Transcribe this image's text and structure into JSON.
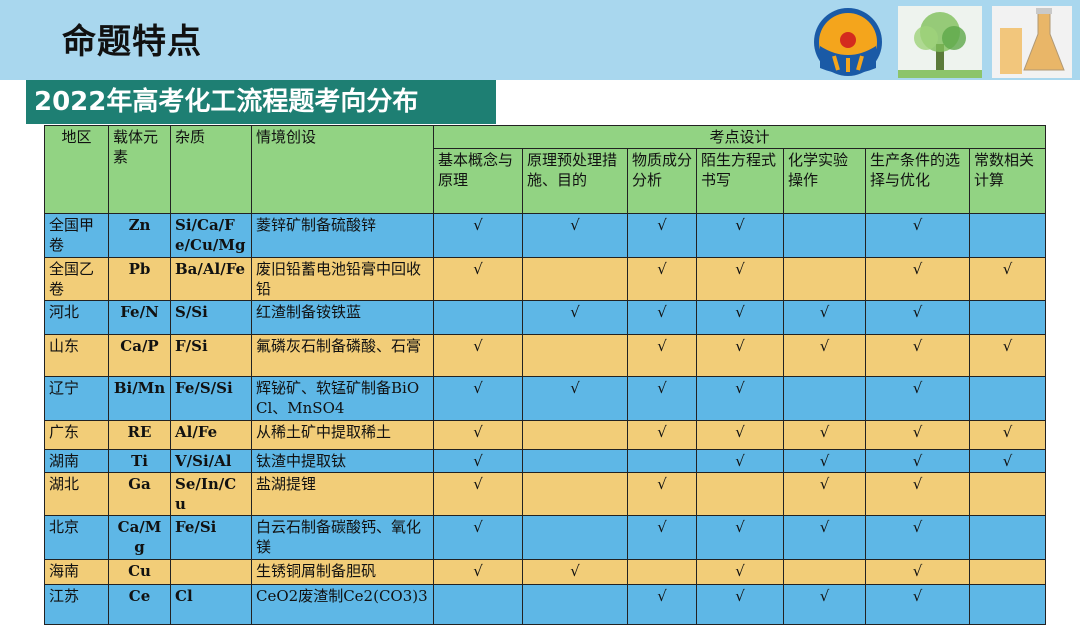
{
  "header": {
    "title": "命题特点",
    "subtitle": "2022年高考化工流程题考向分布"
  },
  "colors": {
    "header_bar": "#a9d7ee",
    "subtitle_bg": "#1e7f73",
    "table_header": "#92d383",
    "row_blue": "#5eb7e6",
    "row_yellow": "#f2cd78"
  },
  "table": {
    "columns": {
      "region": "地区",
      "carrier": "载体元素",
      "impurity": "杂质",
      "scenario": "情境创设",
      "design": "考点设计",
      "sub": [
        "基本概念与原理",
        "原理预处理措施、目的",
        "物质成分分析",
        "陌生方程式书写",
        "化学实验操作",
        "生产条件的选择与优化",
        "常数相关计算"
      ]
    },
    "rows": [
      {
        "region": "全国甲卷",
        "carrier": "Zn",
        "impurity": "Si/Ca/Fe/Cu/Mg",
        "scenario": "菱锌矿制备硫酸锌",
        "marks": [
          "√",
          "√",
          "√",
          "√",
          "",
          "√",
          ""
        ]
      },
      {
        "region": "全国乙卷",
        "carrier": "Pb",
        "impurity": "Ba/Al/Fe",
        "scenario": "废旧铅蓄电池铅膏中回收铅",
        "marks": [
          "√",
          "",
          "√",
          "√",
          "",
          "√",
          "√"
        ]
      },
      {
        "region": "河北",
        "carrier": "Fe/N",
        "impurity": "S/Si",
        "scenario": "红渣制备铵铁蓝",
        "marks": [
          "",
          "√",
          "√",
          "√",
          "√",
          "√",
          ""
        ]
      },
      {
        "region": "山东",
        "carrier": "Ca/P",
        "impurity": "F/Si",
        "scenario": "氟磷灰石制备磷酸、石膏",
        "marks": [
          "√",
          "",
          "√",
          "√",
          "√",
          "√",
          "√"
        ]
      },
      {
        "region": "辽宁",
        "carrier": "Bi/Mn",
        "impurity": "Fe/S/Si",
        "scenario": "辉铋矿、软锰矿制备BiOCl、MnSO4",
        "marks": [
          "√",
          "√",
          "√",
          "√",
          "",
          "√",
          ""
        ]
      },
      {
        "region": "广东",
        "carrier": "RE",
        "impurity": "Al/Fe",
        "scenario": "从稀土矿中提取稀土",
        "marks": [
          "√",
          "",
          "√",
          "√",
          "√",
          "√",
          "√"
        ]
      },
      {
        "region": "湖南",
        "carrier": "Ti",
        "impurity": "V/Si/Al",
        "scenario": "钛渣中提取钛",
        "marks": [
          "√",
          "",
          "",
          "√",
          "√",
          "√",
          "√"
        ]
      },
      {
        "region": "湖北",
        "carrier": "Ga",
        "impurity": "Se/In/Cu",
        "scenario": "盐湖提锂",
        "marks": [
          "√",
          "",
          "√",
          "",
          "√",
          "√",
          ""
        ]
      },
      {
        "region": "北京",
        "carrier": "Ca/Mg",
        "impurity": "Fe/Si",
        "scenario": "白云石制备碳酸钙、氧化镁",
        "marks": [
          "√",
          "",
          "√",
          "√",
          "√",
          "√",
          ""
        ]
      },
      {
        "region": "海南",
        "carrier": "Cu",
        "impurity": "",
        "scenario": "生锈铜屑制备胆矾",
        "marks": [
          "√",
          "√",
          "",
          "√",
          "",
          "√",
          ""
        ]
      },
      {
        "region": "江苏",
        "carrier": "Ce",
        "impurity": "Cl",
        "scenario": "CeO2废渣制Ce2(CO3)3",
        "marks": [
          "",
          "",
          "√",
          "√",
          "√",
          "√",
          ""
        ]
      }
    ]
  }
}
